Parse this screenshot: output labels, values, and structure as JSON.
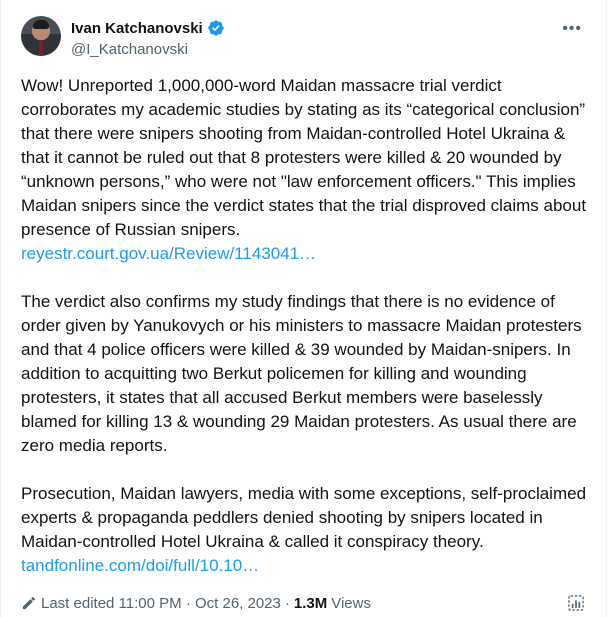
{
  "author": {
    "name": "Ivan Katchanovski",
    "handle": "@I_Katchanovski",
    "verified_color": "#1d9bf0"
  },
  "tweet": {
    "para1": "Wow! Unreported 1,000,000-word Maidan massacre trial verdict corroborates my academic studies by stating as its “categorical conclusion” that there were snipers shooting from Maidan-controlled Hotel Ukraina & that it cannot be ruled out that 8 protesters were killed & 20 wounded by “unknown persons,” who were not \"law enforcement officers.\" This implies Maidan snipers since the verdict states that the trial disproved claims about presence of Russian snipers.",
    "link1": "reyestr.court.gov.ua/Review/1143041…",
    "para2": "The verdict also confirms my study findings that there is no evidence of order given by Yanukovych or his ministers to massacre Maidan protesters and that 4 police officers were killed & 39 wounded by Maidan-snipers. In addition to acquitting two Berkut policemen for killing and wounding protesters, it states that all accused Berkut members were baselessly blamed for killing 13 & wounding 29 Maidan protesters. As usual there are zero media reports.",
    "para3": "Prosecution, Maidan lawyers, media with some exceptions, self-proclaimed experts & propaganda peddlers denied shooting by snipers located in Maidan-controlled Hotel Ukraina & called it conspiracy theory.",
    "link2": "tandfonline.com/doi/full/10.10…"
  },
  "footer": {
    "edited_label": "Last edited 11:00 PM · Oct 26, 2023",
    "separator": "·",
    "views_count": "1.3M",
    "views_label": "Views"
  },
  "icons": {
    "more": "more-options-icon",
    "verified": "verified-badge-icon",
    "edit": "pencil-icon",
    "analytics": "analytics-icon"
  },
  "colors": {
    "link": "#1d9bf0",
    "secondary_text": "#536471",
    "primary_text": "#0f1419"
  }
}
